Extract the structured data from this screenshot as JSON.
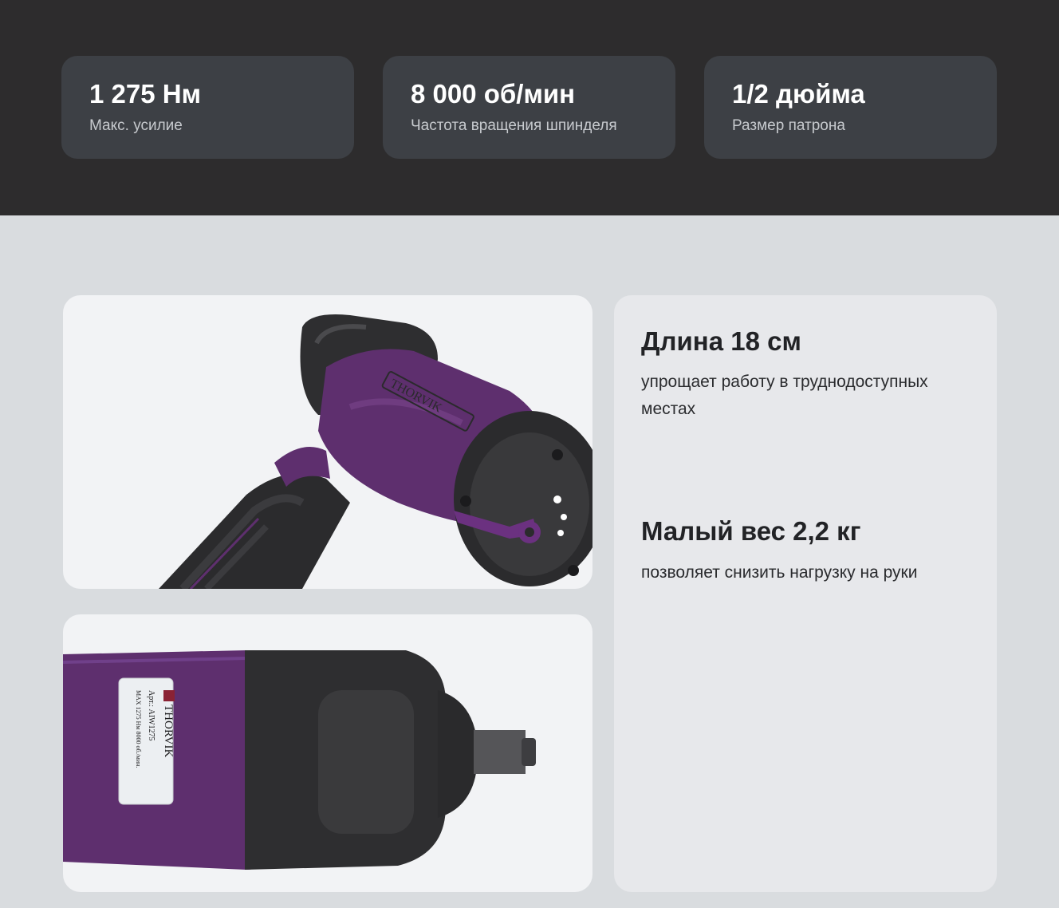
{
  "specs": [
    {
      "value": "1 275 Нм",
      "label": "Макс. усилие"
    },
    {
      "value": "8 000 об/мин",
      "label": "Частота вращения шпинделя"
    },
    {
      "value": "1/2 дюйма",
      "label": "Размер патрона"
    }
  ],
  "features": [
    {
      "title": "Длина 18 см",
      "text": "упрощает работу в труднодоступных местах"
    },
    {
      "title": "Малый вес 2,2 кг",
      "text": "позволяет снизить нагрузку на руки"
    }
  ],
  "product": {
    "brand": "THORVIK",
    "label_art": "Арт.: AIW1275",
    "label_specs": "MAX 1275 Нм   8000 об./мин."
  },
  "colors": {
    "dark_band": "#2d2c2d",
    "spec_card": "#3d4045",
    "tool_purple": "#5e2f6e",
    "tool_black": "#2b2b2d"
  }
}
